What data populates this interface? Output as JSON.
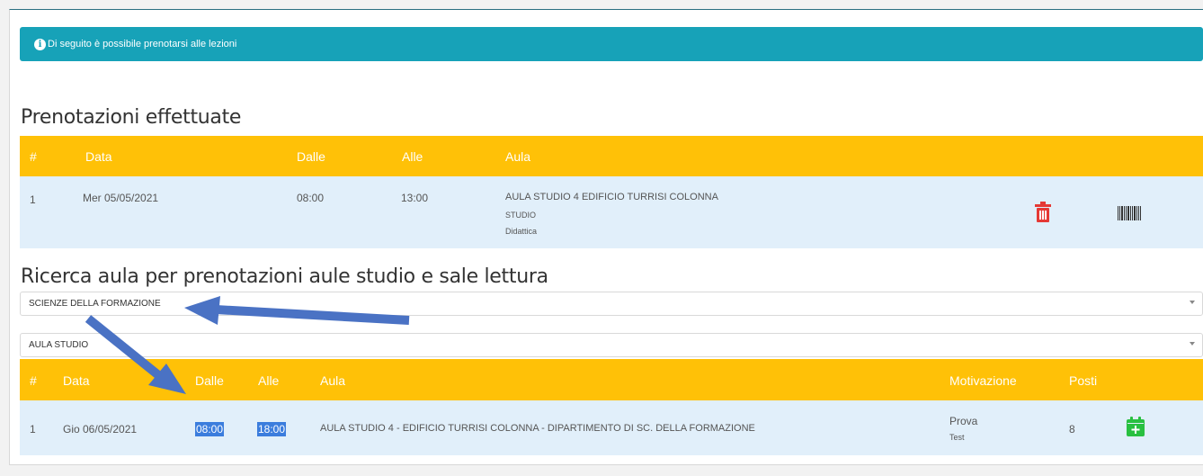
{
  "alert": {
    "text": "Di seguito è possibile prenotarsi alle lezioni",
    "icon": "info-icon"
  },
  "bookings": {
    "title": "Prenotazioni effettuate",
    "headers": {
      "num": "#",
      "data": "Data",
      "dalle": "Dalle",
      "alle": "Alle",
      "aula": "Aula"
    },
    "row": {
      "num": "1",
      "data": "Mer 05/05/2021",
      "dalle": "08:00",
      "alle": "13:00",
      "aula": "AULA STUDIO 4 EDIFICIO TURRISI COLONNA",
      "tipo": "STUDIO",
      "categoria": "Didattica"
    }
  },
  "search": {
    "title": "Ricerca aula per prenotazioni aule studio e sale lettura",
    "select1": "SCIENZE DELLA FORMAZIONE",
    "select2": "AULA STUDIO"
  },
  "results": {
    "headers": {
      "num": "#",
      "data": "Data",
      "dalle": "Dalle",
      "alle": "Alle",
      "aula": "Aula",
      "motivazione": "Motivazione",
      "posti": "Posti"
    },
    "row": {
      "num": "1",
      "data": "Gio 06/05/2021",
      "dalle": "08:00",
      "alle": "18:00",
      "aula": "AULA STUDIO 4 - EDIFICIO TURRISI COLONNA - DIPARTIMENTO DI SC. DELLA FORMAZIONE",
      "motivazione": "Prova",
      "motivazione_sub": "Test",
      "posti": "8"
    }
  },
  "colors": {
    "accent": "#ffc107",
    "info": "#17a2b8",
    "row_bg": "#e1effa",
    "delete": "#e53935",
    "add": "#28c040",
    "arrow": "#4a72c4"
  }
}
